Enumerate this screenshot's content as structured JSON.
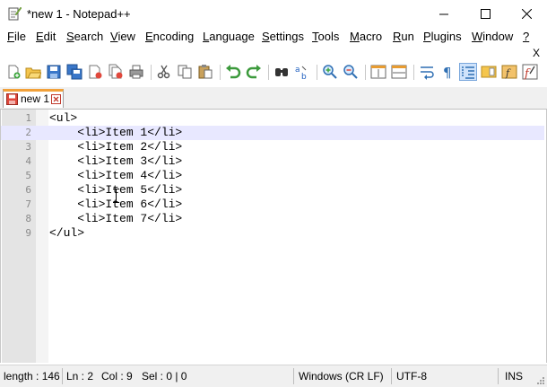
{
  "window": {
    "title": "*new 1 - Notepad++"
  },
  "menu": {
    "items": [
      {
        "name": "file",
        "label": "File",
        "u": "F",
        "rest": "ile"
      },
      {
        "name": "edit",
        "label": "Edit",
        "u": "E",
        "rest": "dit"
      },
      {
        "name": "search",
        "label": "Search",
        "u": "S",
        "rest": "earch"
      },
      {
        "name": "view",
        "label": "View",
        "u": "V",
        "rest": "iew"
      },
      {
        "name": "encoding",
        "label": "Encoding",
        "u": "E",
        "rest": "ncoding"
      },
      {
        "name": "language",
        "label": "Language",
        "u": "L",
        "rest": "anguage"
      },
      {
        "name": "settings",
        "label": "Settings",
        "u": "S",
        "rest": "ettings"
      },
      {
        "name": "tools",
        "label": "Tools",
        "u": "T",
        "rest": "ools"
      },
      {
        "name": "macro",
        "label": "Macro",
        "u": "M",
        "rest": "acro"
      },
      {
        "name": "run",
        "label": "Run",
        "u": "R",
        "rest": "un"
      },
      {
        "name": "plugins",
        "label": "Plugins",
        "u": "P",
        "rest": "lugins"
      },
      {
        "name": "window",
        "label": "Window",
        "u": "W",
        "rest": "indow"
      },
      {
        "name": "help",
        "label": "?",
        "u": "?",
        "rest": ""
      }
    ],
    "close_document": "X"
  },
  "toolbar": {
    "icons": [
      "new-file-icon",
      "open-file-icon",
      "save-icon",
      "save-all-icon",
      "close-icon",
      "close-all-icon",
      "print-icon",
      "cut-icon",
      "copy-icon",
      "paste-icon",
      "undo-icon",
      "redo-icon",
      "find-icon",
      "replace-icon",
      "zoom-in-icon",
      "zoom-out-icon",
      "sync-vertical-icon",
      "sync-horizontal-icon",
      "word-wrap-icon",
      "show-all-characters-icon",
      "indent-guide-icon",
      "document-map-icon",
      "function-list-icon",
      "record-macro-icon"
    ]
  },
  "tabs": [
    {
      "label": "new 1",
      "modified": true
    }
  ],
  "editor": {
    "current_line": 2,
    "lines": [
      {
        "num": "1",
        "text": "<ul>"
      },
      {
        "num": "2",
        "text": "    <li>Item 1</li>"
      },
      {
        "num": "3",
        "text": "    <li>Item 2</li>"
      },
      {
        "num": "4",
        "text": "    <li>Item 3</li>"
      },
      {
        "num": "5",
        "text": "    <li>Item 4</li>"
      },
      {
        "num": "6",
        "text": "    <li>Item 5</li>"
      },
      {
        "num": "7",
        "text": "    <li>Item 6</li>"
      },
      {
        "num": "8",
        "text": "    <li>Item 7</li>"
      },
      {
        "num": "9",
        "text": "</ul>"
      }
    ]
  },
  "status": {
    "length": "length : 146",
    "ln": "Ln : 2",
    "col": "Col : 9",
    "sel": "Sel : 0 | 0",
    "eol": "Windows (CR LF)",
    "encoding": "UTF-8",
    "mode": "INS"
  }
}
